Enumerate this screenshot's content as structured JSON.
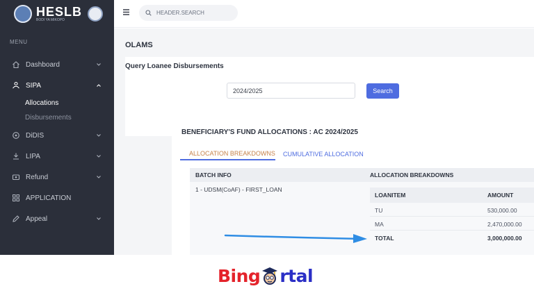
{
  "app": {
    "logo_text": "HESLB",
    "logo_tagline": "BODI YA MIKOPO"
  },
  "sidebar": {
    "menu_caption": "MENU",
    "items": [
      {
        "label": "Dashboard",
        "icon": "home-icon"
      },
      {
        "label": "SIPA",
        "icon": "hand-coins-icon",
        "expanded": true,
        "children": [
          {
            "label": "Allocations",
            "active": true
          },
          {
            "label": "Disbursements",
            "active": false
          }
        ]
      },
      {
        "label": "DiDIS",
        "icon": "network-icon"
      },
      {
        "label": "LIPA",
        "icon": "payment-icon"
      },
      {
        "label": "Refund",
        "icon": "refund-icon"
      },
      {
        "label": "APPLICATION",
        "icon": "grid-icon"
      },
      {
        "label": "Appeal",
        "icon": "pencil-icon"
      }
    ]
  },
  "header": {
    "search_placeholder": "HEADER.SEARCH"
  },
  "main": {
    "page_title": "OLAMS",
    "query": {
      "title": "Query Loanee Disbursements",
      "academic_year": "2024/2025",
      "search_button": "Search",
      "accent_color": "#4e6ce0"
    },
    "result": {
      "title": "BENEFICIARY'S FUND ALLOCATIONS : AC 2024/2025",
      "tabs": [
        {
          "label": "ALLOCATION BREAKDOWNS",
          "active": true
        },
        {
          "label": "CUMULATIVE ALLOCATION",
          "active": false
        }
      ],
      "table": {
        "columns": [
          "BATCH INFO",
          "ALLOCATION BREAKDOWNS"
        ],
        "batch": "1 - UDSM(CoAF) - FIRST_LOAN",
        "breakdown": {
          "columns": [
            "LOANITEM",
            "AMOUNT"
          ],
          "rows": [
            {
              "item": "TU",
              "amount": "530,000.00"
            },
            {
              "item": "MA",
              "amount": "2,470,000.00"
            }
          ],
          "total": {
            "item": "TOTAL",
            "amount": "3,000,000.00"
          }
        }
      }
    }
  },
  "banner": {
    "brand_part1": "Bing",
    "brand_mascot_letter": "o",
    "brand_part2": "rtal",
    "brand_prefix_color": "#e4232b",
    "brand_suffix_color": "#2b2fc6"
  }
}
